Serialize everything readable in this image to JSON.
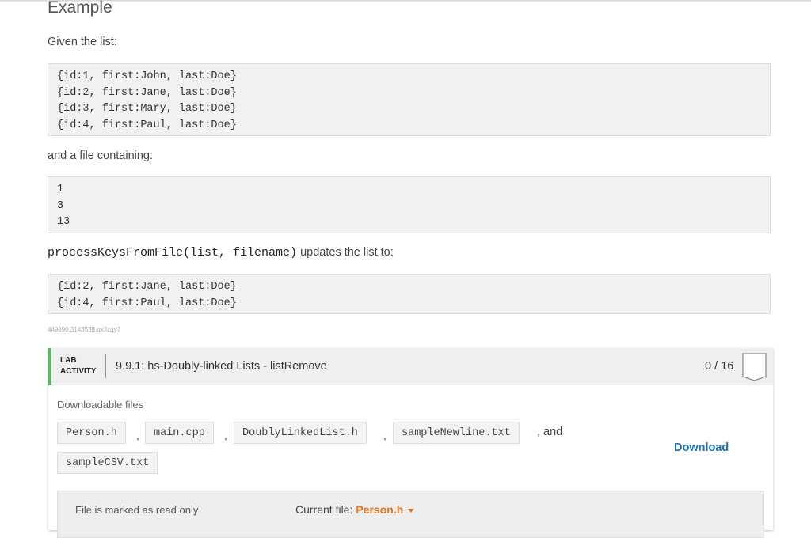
{
  "section": {
    "heading": "Example",
    "given_text": "Given the list:",
    "given_list": [
      "{id:1, first:John, last:Doe}",
      "{id:2, first:Jane, last:Doe}",
      "{id:3, first:Mary, last:Doe}",
      "{id:4, first:Paul, last:Doe}"
    ],
    "file_text": "and a file containing:",
    "file_lines": [
      "1",
      "3",
      "13"
    ],
    "call_code": "processKeysFromFile(list, filename)",
    "call_text": " updates the list to:",
    "result_list": [
      "{id:2, first:Jane, last:Doe}",
      "{id:4, first:Paul, last:Doe}"
    ],
    "tracking_id": "449890.3143538.qx3zqy7"
  },
  "lab": {
    "tag_line1": "LAB",
    "tag_line2": "ACTIVITY",
    "title": "9.9.1: hs-Doubly-linked Lists - listRemove",
    "score": "0 / 16",
    "downloadable_label": "Downloadable files",
    "files": [
      "Person.h",
      "main.cpp",
      "DoublyLinkedList.h",
      "sampleNewline.txt",
      "sampleCSV.txt"
    ],
    "comma": ",",
    "and_text": ", and",
    "download_label": "Download",
    "readonly_text": "File is marked as read only",
    "current_file_label": "Current file:",
    "current_file_name": "Person.h"
  },
  "colors": {
    "accent_green": "#5cb85c",
    "link_blue": "#1f6fb2",
    "current_file_orange": "#e8761e"
  }
}
